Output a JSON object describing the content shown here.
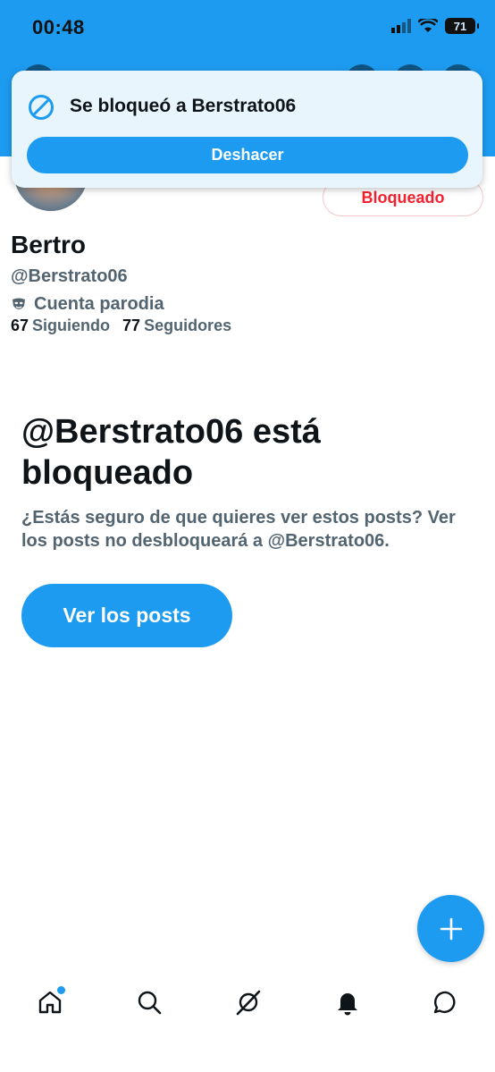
{
  "status_bar": {
    "time": "00:48",
    "battery": "71"
  },
  "toast": {
    "icon": "blocked-icon",
    "message": "Se bloqueó a Berstrato06",
    "undo_label": "Deshacer"
  },
  "profile": {
    "blocked_label": "Bloqueado",
    "name": "Bertro",
    "handle": "@Berstrato06",
    "parody_label": "Cuenta parodia",
    "following_count": "67",
    "following_label": "Siguiendo",
    "followers_count": "77",
    "followers_label": "Seguidores"
  },
  "blocked_notice": {
    "title": "@Berstrato06 está bloqueado",
    "description": "¿Estás seguro de que quieres ver estos posts? Ver los posts no desbloqueará a @Berstrato06.",
    "view_posts_label": "Ver los posts"
  },
  "tabbar": {
    "items": [
      "home-icon",
      "search-icon",
      "grok-icon",
      "notifications-icon",
      "messages-icon"
    ]
  },
  "colors": {
    "accent": "#1d9bf0",
    "danger": "#f4212e",
    "secondary_text": "#536471"
  }
}
